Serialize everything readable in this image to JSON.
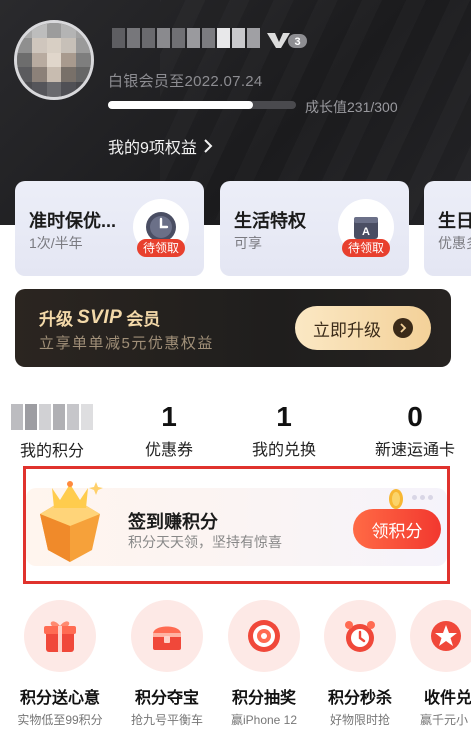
{
  "header": {
    "vip_level": "3",
    "member_until": "白银会员至2022.07.24",
    "growth": {
      "label": "成长值231/300",
      "current": 231,
      "max": 300
    },
    "benefits_link": "我的9项权益"
  },
  "benefit_cards": [
    {
      "title": "准时保优...",
      "subtitle": "1次/半年",
      "tag": "待领取",
      "icon": "clock-icon"
    },
    {
      "title": "生活特权",
      "subtitle": "可享",
      "tag": "待领取",
      "icon": "calendar-icon"
    },
    {
      "title": "生日",
      "subtitle": "优惠多",
      "icon": "gift-icon"
    }
  ],
  "svip": {
    "prefix": "升级",
    "mark": "SVIP",
    "suffix": "会员",
    "subtitle": "立享单单减5元优惠权益",
    "button": "立即升级"
  },
  "stats": [
    {
      "value": "",
      "label": "我的积分"
    },
    {
      "value": "1",
      "label": "优惠券"
    },
    {
      "value": "1",
      "label": "我的兑换"
    },
    {
      "value": "0",
      "label": "新速运通卡"
    }
  ],
  "checkin": {
    "title": "签到赚积分",
    "subtitle": "积分天天领，坚持有惊喜",
    "button": "领积分"
  },
  "menu": [
    {
      "label": "积分送心意",
      "sub": "实物低至99积分",
      "icon": "gift-box-icon"
    },
    {
      "label": "积分夺宝",
      "sub": "抢九号平衡车",
      "icon": "treasure-chest-icon"
    },
    {
      "label": "积分抽奖",
      "sub": "赢iPhone 12",
      "icon": "lottery-wheel-icon"
    },
    {
      "label": "积分秒杀",
      "sub": "好物限时抢",
      "icon": "alarm-clock-icon"
    },
    {
      "label": "收件兑",
      "sub": "赢千元小",
      "icon": "star-badge-icon"
    }
  ],
  "colors": {
    "header_bg": "#1f1f21",
    "accent_red": "#e8402e",
    "gold": "#f3d9a9",
    "highlight_border": "#e0322d"
  }
}
